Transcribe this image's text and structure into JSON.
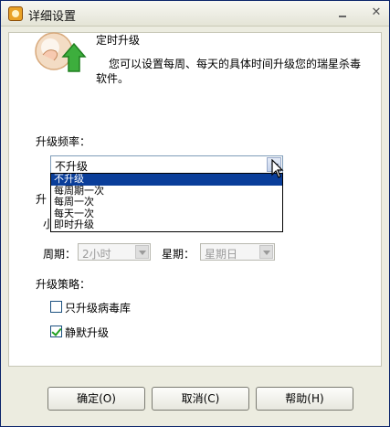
{
  "window": {
    "title": "详细设置"
  },
  "header": {
    "heading": "定时升级",
    "description": "您可以设置每周、每天的具体时间升级您的瑞星杀毒软件。"
  },
  "frequency": {
    "label": "升级频率：",
    "selected": "不升级",
    "options": [
      "不升级",
      "每周期一次",
      "每周一次",
      "每天一次",
      "即时升级"
    ]
  },
  "obscured": {
    "label1": "升",
    "label2": "小"
  },
  "schedule": {
    "period_label": "周期：",
    "period_value": "2小时",
    "weekday_label": "星期：",
    "weekday_value": "星期日"
  },
  "strategy": {
    "label": "升级策略：",
    "options": [
      {
        "label": "只升级病毒库",
        "checked": false
      },
      {
        "label": "静默升级",
        "checked": true
      }
    ]
  },
  "buttons": {
    "ok": "确定(O)",
    "cancel": "取消(C)",
    "help": "帮助(H)"
  },
  "icons": {
    "hero": "update-globe-icon",
    "app": "rising-lion-icon"
  }
}
